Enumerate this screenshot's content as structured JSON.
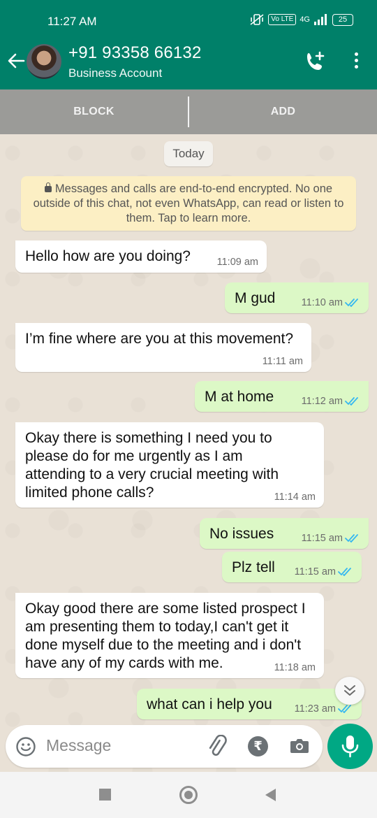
{
  "status_bar": {
    "time": "11:27 AM",
    "volte": "Vo LTE",
    "network": "4G",
    "battery": "25"
  },
  "header": {
    "contact_name": "+91 93358 66132",
    "subtitle": "Business Account"
  },
  "actions": {
    "block": "BLOCK",
    "add": "ADD"
  },
  "chat": {
    "date_chip": "Today",
    "encryption_notice": "Messages and calls are end-to-end encrypted. No one outside of this chat, not even WhatsApp, can read or listen to them. Tap to learn more.",
    "messages": [
      {
        "direction": "in",
        "text": "Hello how are you doing?",
        "time": "11:09 am"
      },
      {
        "direction": "out",
        "text": "M gud",
        "time": "11:10 am",
        "status": "read"
      },
      {
        "direction": "in",
        "text": "I’m fine where are you at this movement?",
        "time": "11:11 am"
      },
      {
        "direction": "out",
        "text": "M at home",
        "time": "11:12 am",
        "status": "read"
      },
      {
        "direction": "in",
        "text": "Okay there is something I need you to please do for me urgently as I am attending to a very crucial meeting with limited phone calls?",
        "time": "11:14 am"
      },
      {
        "direction": "out",
        "text": "No issues",
        "time": "11:15 am",
        "status": "read"
      },
      {
        "direction": "out",
        "text": "Plz tell",
        "time": "11:15 am",
        "status": "read"
      },
      {
        "direction": "in",
        "text": "Okay good there are some listed prospect I am presenting them to today,I can't get it done myself due to the meeting and i don't have any of my cards with me.",
        "time": "11:18 am"
      },
      {
        "direction": "out",
        "text": "what can i help you",
        "time": "11:23 am",
        "status": "read"
      }
    ]
  },
  "input": {
    "placeholder": "Message",
    "rupee_symbol": "₹"
  },
  "colors": {
    "header": "#008069",
    "outgoing_bubble": "#dcf8c6",
    "incoming_bubble": "#ffffff",
    "read_tick": "#34b7f1",
    "mic_button": "#00a884"
  }
}
